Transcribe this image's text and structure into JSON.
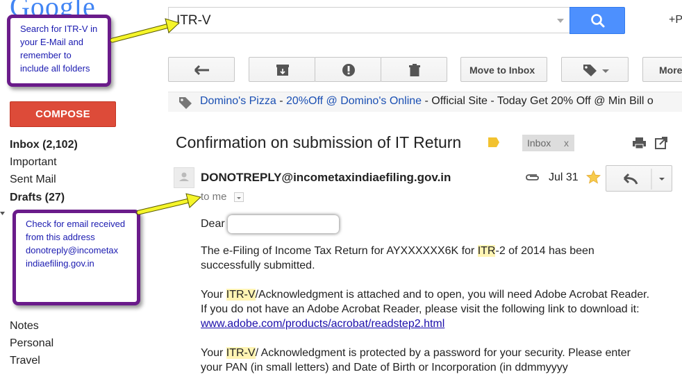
{
  "logo": {
    "text": "Google"
  },
  "search": {
    "value": "ITR-V"
  },
  "header": {
    "plus_label": "+P"
  },
  "toolbar": {
    "move_to_inbox_label": "Move to Inbox",
    "more_label": "More"
  },
  "ad": {
    "sponsor": "Domino's Pizza",
    "separator1": " - ",
    "link_text": "20%Off @ Domino's Online",
    "description": " - Official Site - Today Get 20% Off @ Min Bill o"
  },
  "sidebar": {
    "compose_label": "COMPOSE",
    "items": [
      {
        "label": "Inbox (2,102)"
      },
      {
        "label": "Important"
      },
      {
        "label": "Sent Mail"
      },
      {
        "label": "Drafts (27)"
      },
      {
        "label": "Notes"
      },
      {
        "label": "Personal"
      },
      {
        "label": "Travel"
      }
    ]
  },
  "message": {
    "subject": "Confirmation on submission of IT Return",
    "label_chip": "Inbox",
    "label_chip_close": "x",
    "sender": "DONOTREPLY@incometaxindiaefiling.gov.in",
    "date": "Jul 31",
    "to": "to me",
    "greeting": "Dear",
    "p1_a": "The e-Filing of Income Tax Return for AYXXXXXX6K for ",
    "p1_hl": "ITR",
    "p1_b": "-2 of 2014 has been successfully submitted.",
    "p2_a": "Your ",
    "p2_hl": "ITR-V",
    "p2_b": "/Acknowledgment is attached and to open, you will need Adobe Acrobat Reader. If you do not have an Adobe Acrobat Reader, please visit the following link to download it: ",
    "p2_link": "www.adobe.com/products/acrobat/readstep2.html",
    "p3_a": "Your ",
    "p3_hl": "ITR-V",
    "p3_b": "/ Acknowledgment is protected by a password for your security. Please enter your PAN (in small letters) and Date of Birth or Incorporation (in ddmmyyyy"
  },
  "callouts": {
    "search_note": "Search for ITR-V in your E-Mail and remember to include all folders",
    "sender_note": "Check for email received from this address donotreply@incometax indiaefiling.gov.in"
  },
  "colors": {
    "callout_border": "#6a1b8a",
    "arrow": "#f5f52a",
    "compose": "#dd4b39",
    "search_button": "#4d90fe",
    "highlight": "#fff4b3"
  }
}
